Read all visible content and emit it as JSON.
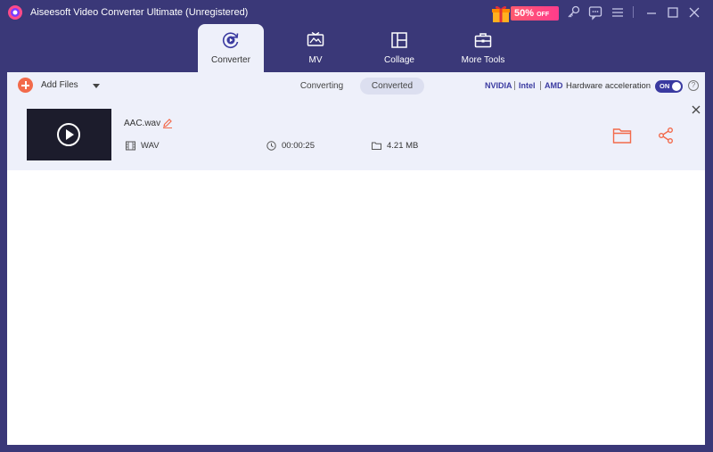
{
  "window": {
    "title": "Aiseesoft Video Converter Ultimate (Unregistered)",
    "promo": {
      "percent": "50%",
      "suffix": "OFF"
    }
  },
  "tabs": [
    {
      "label": "Converter",
      "icon": "convert-icon",
      "active": true
    },
    {
      "label": "MV",
      "icon": "tv-icon"
    },
    {
      "label": "Collage",
      "icon": "collage-icon"
    },
    {
      "label": "More Tools",
      "icon": "toolbox-icon"
    }
  ],
  "toolbar": {
    "add_files_label": "Add Files",
    "subtabs": {
      "converting": "Converting",
      "converted": "Converted"
    },
    "hardware": {
      "nvidia": "NVIDIA",
      "intel": "Intel",
      "amd": "AMD",
      "label": "Hardware acceleration",
      "toggle_state": "ON"
    },
    "help": "?"
  },
  "file": {
    "name": "AAC.wav",
    "format": "WAV",
    "duration": "00:00:25",
    "size": "4.21 MB"
  },
  "colors": {
    "background": "#3a3878",
    "accent": "#f26a4b",
    "brand": "#3a3aa0",
    "panel": "#eef0fa"
  }
}
